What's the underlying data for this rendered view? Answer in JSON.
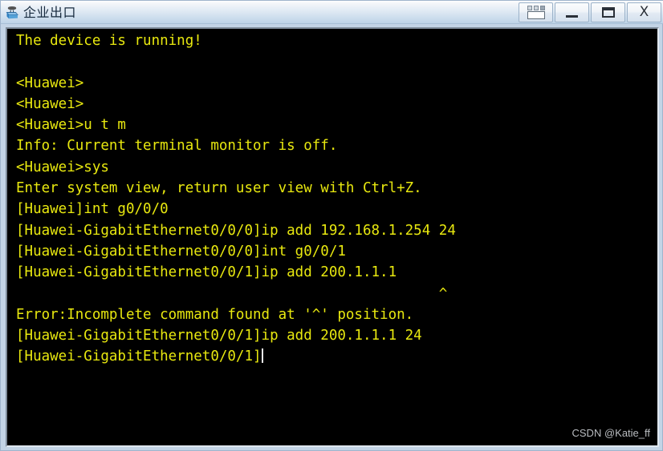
{
  "window": {
    "title": "企业出口",
    "icon": "router-icon",
    "buttons": [
      {
        "name": "cascade-button",
        "label": "",
        "icon": "cascade-icon"
      },
      {
        "name": "minimize-button",
        "label": "",
        "icon": "minimize-icon"
      },
      {
        "name": "maximize-button",
        "label": "",
        "icon": "maximize-icon"
      },
      {
        "name": "close-button",
        "label": "X",
        "icon": "close-icon"
      }
    ]
  },
  "terminal": {
    "foreground_color": "#e8e80f",
    "background_color": "#000000",
    "cursor_color": "#e8e8e8",
    "lines": [
      "The device is running!",
      "",
      "<Huawei>",
      "<Huawei>",
      "<Huawei>u t m",
      "Info: Current terminal monitor is off.",
      "<Huawei>sys",
      "Enter system view, return user view with Ctrl+Z.",
      "[Huawei]int g0/0/0",
      "[Huawei-GigabitEthernet0/0/0]ip add 192.168.1.254 24",
      "[Huawei-GigabitEthernet0/0/0]int g0/0/1",
      "[Huawei-GigabitEthernet0/0/1]ip add 200.1.1.1",
      "                                                  ^",
      "Error:Incomplete command found at '^' position.",
      "[Huawei-GigabitEthernet0/0/1]ip add 200.1.1.1 24",
      "[Huawei-GigabitEthernet0/0/1]"
    ],
    "prompt_line_index": 15
  },
  "watermark": {
    "text": "CSDN @Katie_ff"
  }
}
